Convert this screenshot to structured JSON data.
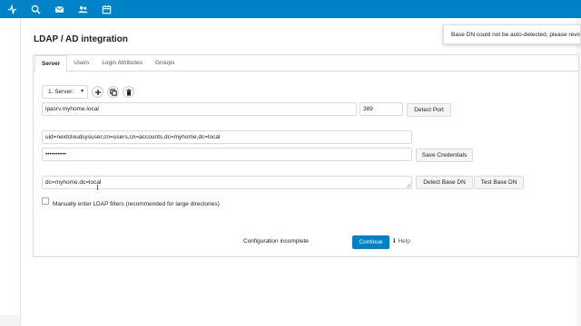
{
  "topbar": {
    "icons": [
      "activity-icon",
      "search-icon",
      "mail-icon",
      "contacts-icon",
      "calendar-icon"
    ],
    "color": "#0082c9"
  },
  "page": {
    "title": "LDAP / AD integration"
  },
  "toast": {
    "text": "Base DN could not be auto-detected, please revise"
  },
  "tabs": [
    {
      "label": "Server",
      "active": true
    },
    {
      "label": "Users",
      "active": false
    },
    {
      "label": "Login Attributes",
      "active": false
    },
    {
      "label": "Groups",
      "active": false
    }
  ],
  "server": {
    "select_label": "1. Server:",
    "host": "ipasrv.myhome.local",
    "port": "389",
    "detect_port_label": "Detect Port",
    "user_dn": "uid=nextcloudsysuser,cn=users,cn=accounts,dc=myhome,dc=local",
    "password_mask": "••••••••••",
    "save_credentials_label": "Save Credentials",
    "base_dn": "dc=myhome,dc=local",
    "detect_base_dn_label": "Detect Base DN",
    "test_base_dn_label": "Test Base DN",
    "manual_filter_label": "Manually enter LDAP filters (recommended for large directories)",
    "manual_filter_checked": false
  },
  "footer": {
    "status": "Configuration incomplete",
    "continue_label": "Continue",
    "help_label": "Help"
  },
  "colors": {
    "accent": "#0082c9"
  }
}
